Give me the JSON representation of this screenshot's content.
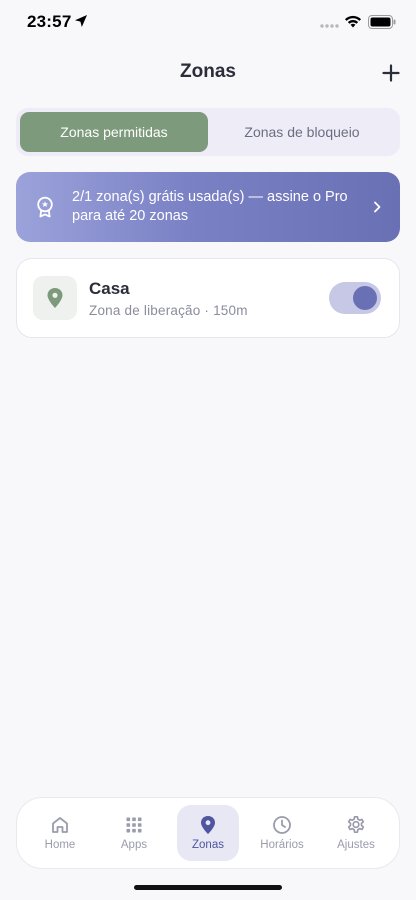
{
  "status_bar": {
    "time": "23:57"
  },
  "header": {
    "title": "Zonas"
  },
  "segmented": {
    "options": [
      {
        "label": "Zonas permitidas",
        "active": true
      },
      {
        "label": "Zonas de bloqueio",
        "active": false
      }
    ]
  },
  "pro_banner": {
    "text": "2/1 zona(s) grátis usada(s) — assine o Pro para até 20 zonas"
  },
  "zones": [
    {
      "name": "Casa",
      "subtitle": "Zona de liberação · 150m",
      "enabled": true
    }
  ],
  "tab_bar": {
    "tabs": [
      {
        "label": "Home",
        "icon": "home-icon",
        "active": false
      },
      {
        "label": "Apps",
        "icon": "grid-icon",
        "active": false
      },
      {
        "label": "Zonas",
        "icon": "map-pin-icon",
        "active": true
      },
      {
        "label": "Horários",
        "icon": "clock-icon",
        "active": false
      },
      {
        "label": "Ajustes",
        "icon": "gear-icon",
        "active": false
      }
    ]
  },
  "colors": {
    "accent": "#6a70b4",
    "segment_active": "#7d9a7c",
    "background": "#f8f8fb"
  }
}
